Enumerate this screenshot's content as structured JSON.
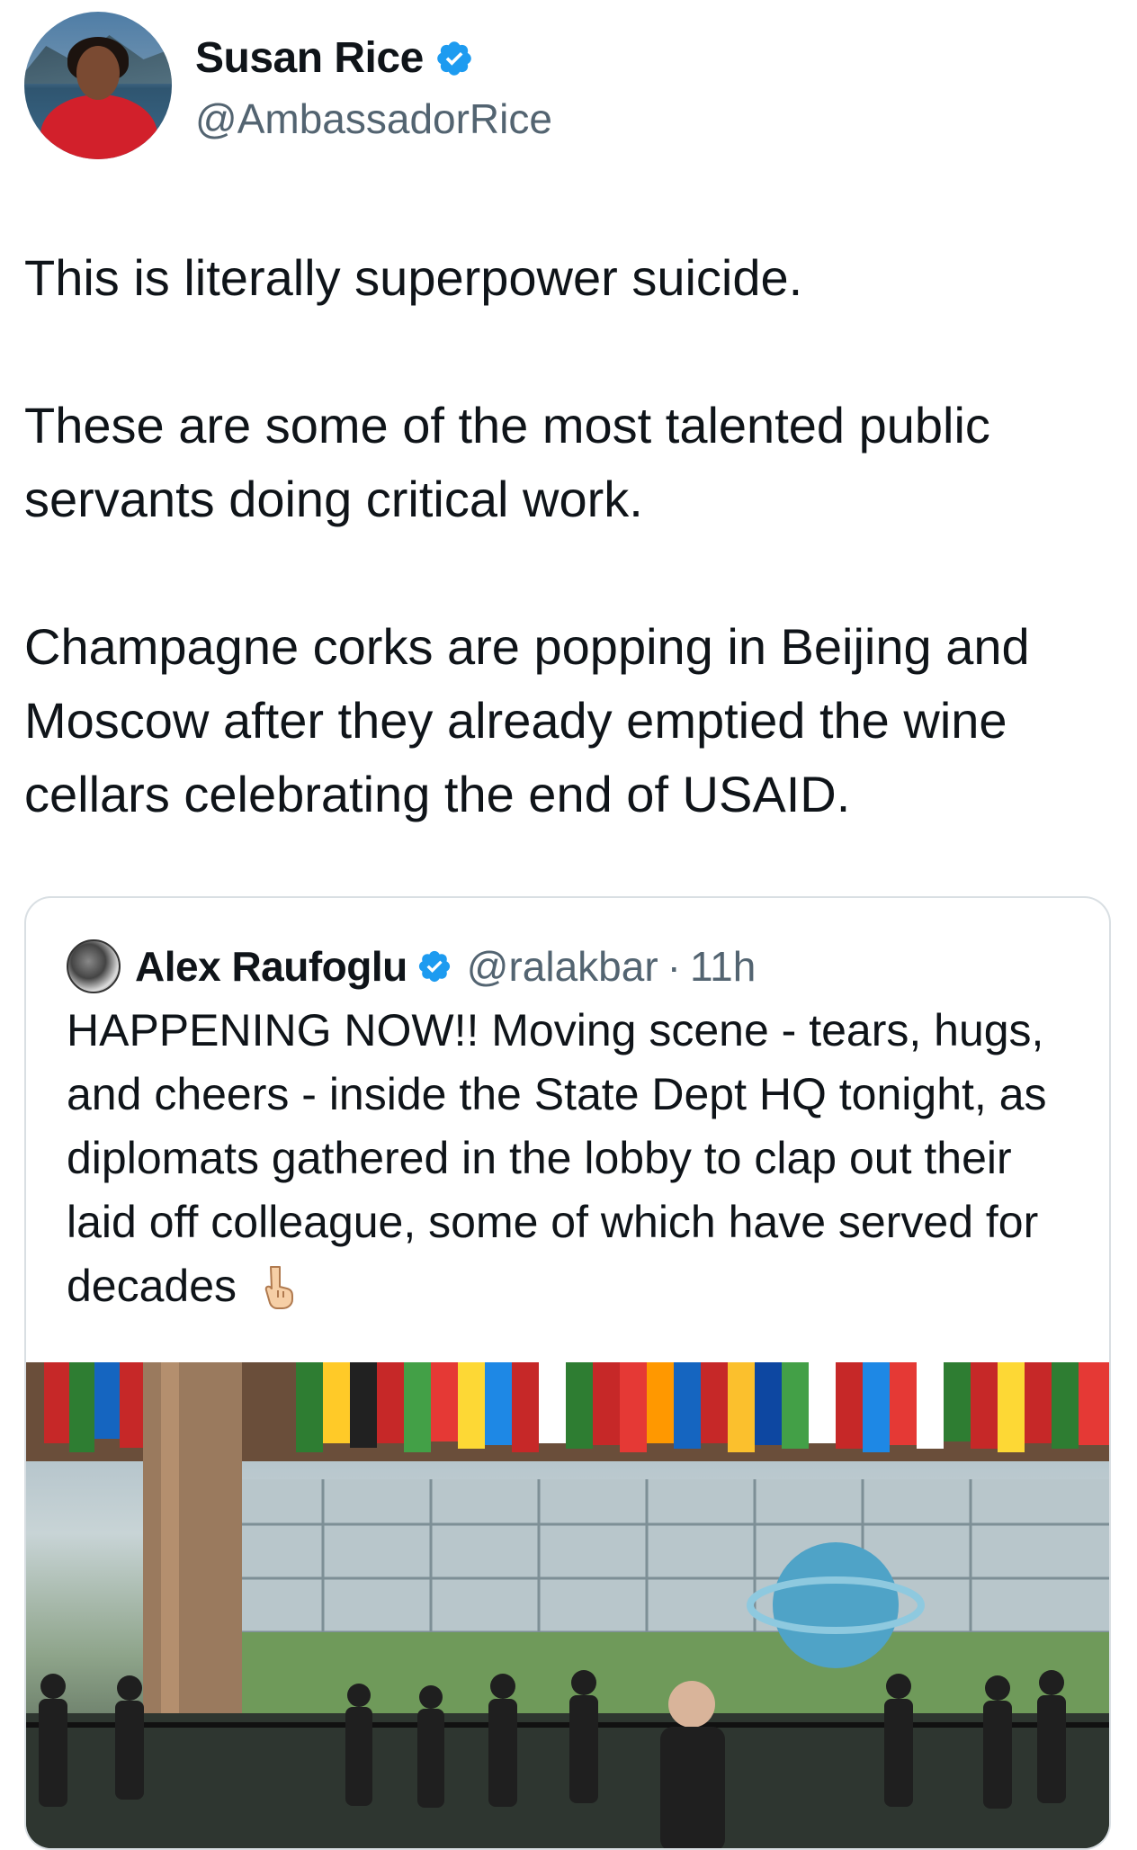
{
  "author": {
    "name": "Susan Rice",
    "handle": "@AmbassadorRice",
    "verified": true
  },
  "tweet": {
    "paragraphs": [
      "This is literally superpower suicide.",
      "These are some of the most talented public servants doing critical work.",
      "Champagne corks are popping in Beijing and Moscow after they already emptied the wine cellars celebrating the end of USAID."
    ]
  },
  "quoted_tweet": {
    "name": "Alex Raufoglu",
    "handle": "@ralakbar",
    "separator": "·",
    "time": "11h",
    "text": "HAPPENING NOW!!  Moving scene - tears, hugs, and cheers - inside the State Dept HQ tonight, as diplomats gathered in the lobby to clap out their laid off colleague, some of which have served for decades",
    "emoji_icon": "backhand-index-pointing-down-icon"
  },
  "colors": {
    "verified_blue": "#1d9bf0",
    "text_primary": "#0f1419",
    "text_secondary": "#536471",
    "border": "#d9dfe3"
  }
}
